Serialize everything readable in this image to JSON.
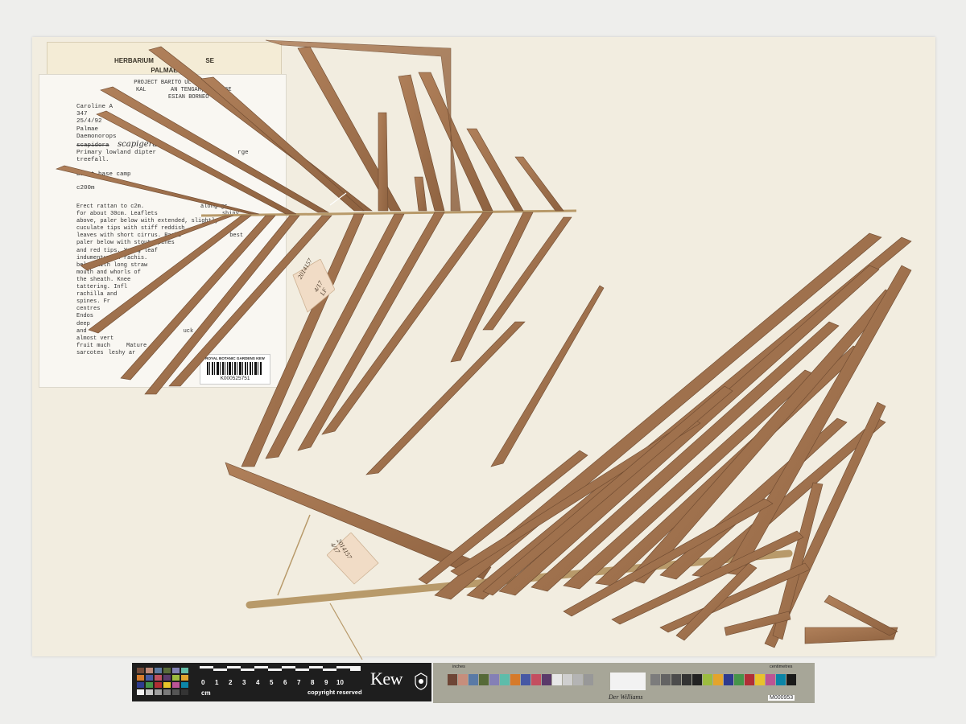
{
  "herbarium_label": {
    "heading_line1": "HERBARIUM",
    "heading_line1b": "SE",
    "heading_line2": "PALMAE",
    "project_line1": "PROJECT BARITO UL",
    "project_line2": "KAL",
    "project_line2b": "AN TENGAH, 114'06E",
    "project_line3": "ESIAN BORNEO"
  },
  "specimen_label": {
    "meta_lines": [
      "Caroline A",
      "347",
      "25/4/92",
      "Palmae",
      "Daemonorops",
      "scapidora",
      "Primary lowland dipter",
      "treefall."
    ],
    "meta_large_suffix": "rge",
    "handwritten_epithet": "scapigera",
    "base_camp": "Bakut base camp",
    "altitude": "c200m",
    "description_lines": [
      "Erect rattan to c2m.",
      "for about 30cm. Leaflets",
      "above, paler below with extended,",
      "cuculate tips with stiff reddish",
      "leaves with short cirrus. Rachi",
      "paler below with stout spines",
      "and red tips. Young leaf",
      "indumentum on rachis.",
      "below with long straw",
      "mouth and whorls of",
      "the sheath. Knee",
      "tattering. Infl",
      "rachilla and",
      "spines. Fr",
      "centres",
      "Endos",
      "deep",
      "and",
      "almost vert",
      "fruit much",
      "sarcotes"
    ],
    "description_fragments": {
      "along_gr": "along gr",
      "shiny": "shiny",
      "slightly": "slightly",
      "best": "best",
      "ripe_tuck": "uck and",
      "mature": "Mature",
      "fleshy": "leshy ar"
    }
  },
  "barcode": {
    "institution": "ROYAL BOTANIC GARDENS KEW",
    "number": "K000525751"
  },
  "tags": {
    "upper_tag_lines": [
      "2014157",
      "4/17",
      "LF"
    ],
    "lower_tag_lines": [
      "2014157",
      "4/17"
    ]
  },
  "scale_bar": {
    "unit": "cm",
    "ticks": [
      "0",
      "1",
      "2",
      "3",
      "4",
      "5",
      "6",
      "7",
      "8",
      "9",
      "10"
    ],
    "copyright": "copyright reserved",
    "brand": "Kew"
  },
  "color_card": {
    "unit_left": "inches",
    "unit_right": "centimetres",
    "brand": "Der Williams",
    "catalog": "M000953"
  },
  "colors": {
    "leaf": "#a07250",
    "leaf_dark": "#7a5236",
    "leaf_light": "#b88a62",
    "rachis": "#b89a6a",
    "sheet": "#f2ede0"
  }
}
